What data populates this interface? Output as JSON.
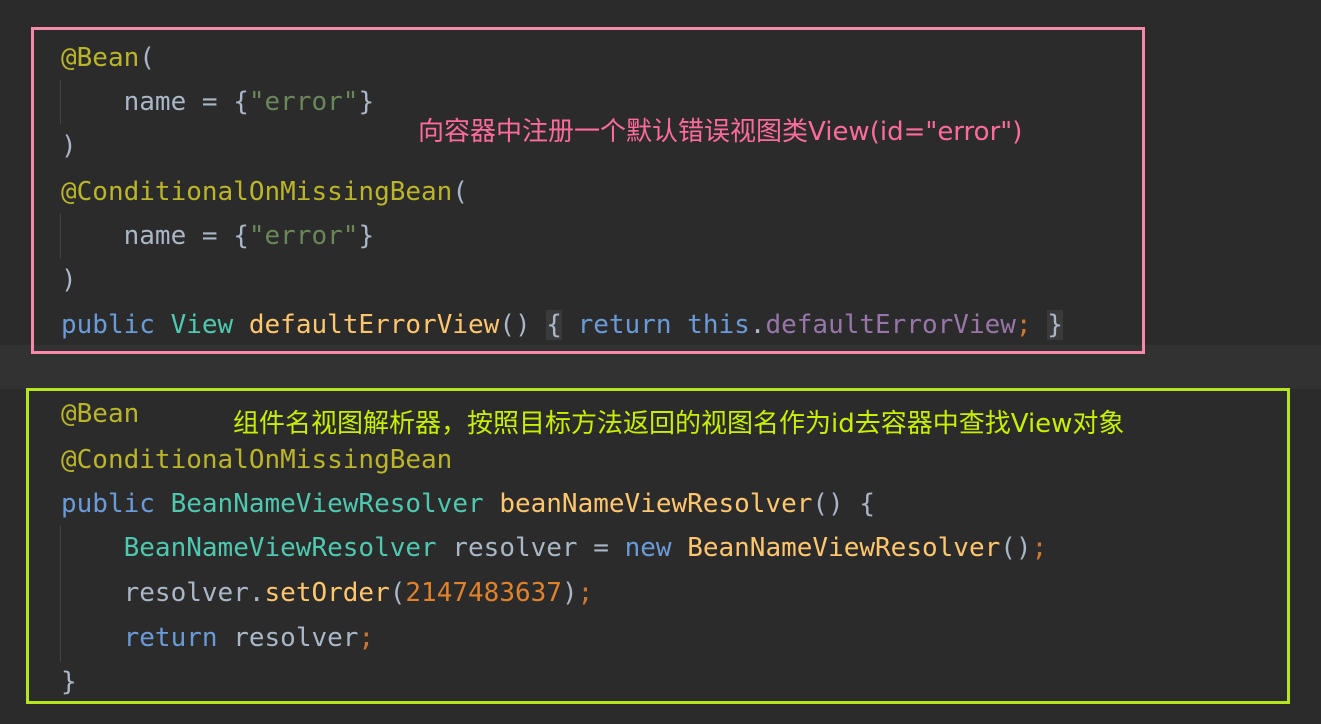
{
  "block1": {
    "line1": {
      "ann": "@Bean",
      "paren": "("
    },
    "line2": {
      "indent": "    ",
      "key": "name",
      "eq": " = ",
      "lbrace": "{",
      "value": "\"error\"",
      "rbrace": "}"
    },
    "line3": {
      "paren": ")"
    },
    "line4": {
      "ann": "@ConditionalOnMissingBean",
      "paren": "("
    },
    "line5": {
      "indent": "    ",
      "key": "name",
      "eq": " = ",
      "lbrace": "{",
      "value": "\"error\"",
      "rbrace": "}"
    },
    "line6": {
      "paren": ")"
    },
    "line7": {
      "kw_public": "public",
      "type": "View",
      "method": "defaultErrorView",
      "parens": "()",
      "lbrace": "{",
      "kw_return": "return",
      "kw_this": "this",
      "dot": ".",
      "field": "defaultErrorView",
      "semi": ";",
      "rbrace": "}"
    },
    "note": "向容器中注册一个默认错误视图类View(id=\"error\")"
  },
  "block2": {
    "line1": {
      "ann": "@Bean"
    },
    "line2": {
      "ann": "@ConditionalOnMissingBean"
    },
    "line3": {
      "kw_public": "public",
      "type": "BeanNameViewResolver",
      "method": "beanNameViewResolver",
      "parens": "()",
      "lbrace": "{"
    },
    "line4": {
      "type": "BeanNameViewResolver",
      "var": "resolver",
      "eq": "=",
      "kw_new": "new",
      "ctor": "BeanNameViewResolver",
      "parens": "()",
      "semi": ";"
    },
    "line5": {
      "obj": "resolver",
      "dot": ".",
      "method": "setOrder",
      "lparen": "(",
      "number": "2147483637",
      "rparen": ")",
      "semi": ";"
    },
    "line6": {
      "kw_return": "return",
      "var": "resolver",
      "semi": ";"
    },
    "line7": {
      "rbrace": "}"
    },
    "note": "组件名视图解析器，按照目标方法返回的视图名作为id去容器中查找View对象"
  },
  "colors": {
    "background": "#2b2b2b",
    "pink_box": "#f58ba8",
    "green_box": "#b5e61d",
    "pink_note": "#ff6b9a",
    "green_note": "#c6f000"
  }
}
